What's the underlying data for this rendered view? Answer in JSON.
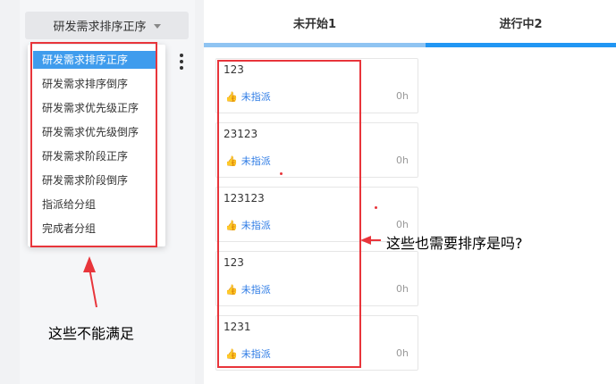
{
  "sort_button": {
    "label": "研发需求排序正序"
  },
  "menu": {
    "items": [
      {
        "label": "研发需求排序正序",
        "selected": true
      },
      {
        "label": "研发需求排序倒序",
        "selected": false
      },
      {
        "label": "研发需求优先级正序",
        "selected": false
      },
      {
        "label": "研发需求优先级倒序",
        "selected": false
      },
      {
        "label": "研发需求阶段正序",
        "selected": false
      },
      {
        "label": "研发需求阶段倒序",
        "selected": false
      },
      {
        "label": "指派给分组",
        "selected": false
      },
      {
        "label": "完成者分组",
        "selected": false
      }
    ]
  },
  "tabs": [
    {
      "label": "未开始1",
      "bar_color": "#8fc4f2"
    },
    {
      "label": "进行中2",
      "bar_color": "#2196f3"
    }
  ],
  "cards": [
    {
      "title": "123",
      "assign": "未指派",
      "hours": "0h"
    },
    {
      "title": "23123",
      "assign": "未指派",
      "hours": "0h"
    },
    {
      "title": "123123",
      "assign": "未指派",
      "hours": "0h"
    },
    {
      "title": "123",
      "assign": "未指派",
      "hours": "0h"
    },
    {
      "title": "1231",
      "assign": "未指派",
      "hours": "0h"
    }
  ],
  "annotations": {
    "left_note": "这些不能满足",
    "right_note": "这些也需要排序是吗?"
  },
  "colors": {
    "annotation": "#e8353b",
    "accent": "#2d7be5",
    "selected": "#3f9ced"
  }
}
